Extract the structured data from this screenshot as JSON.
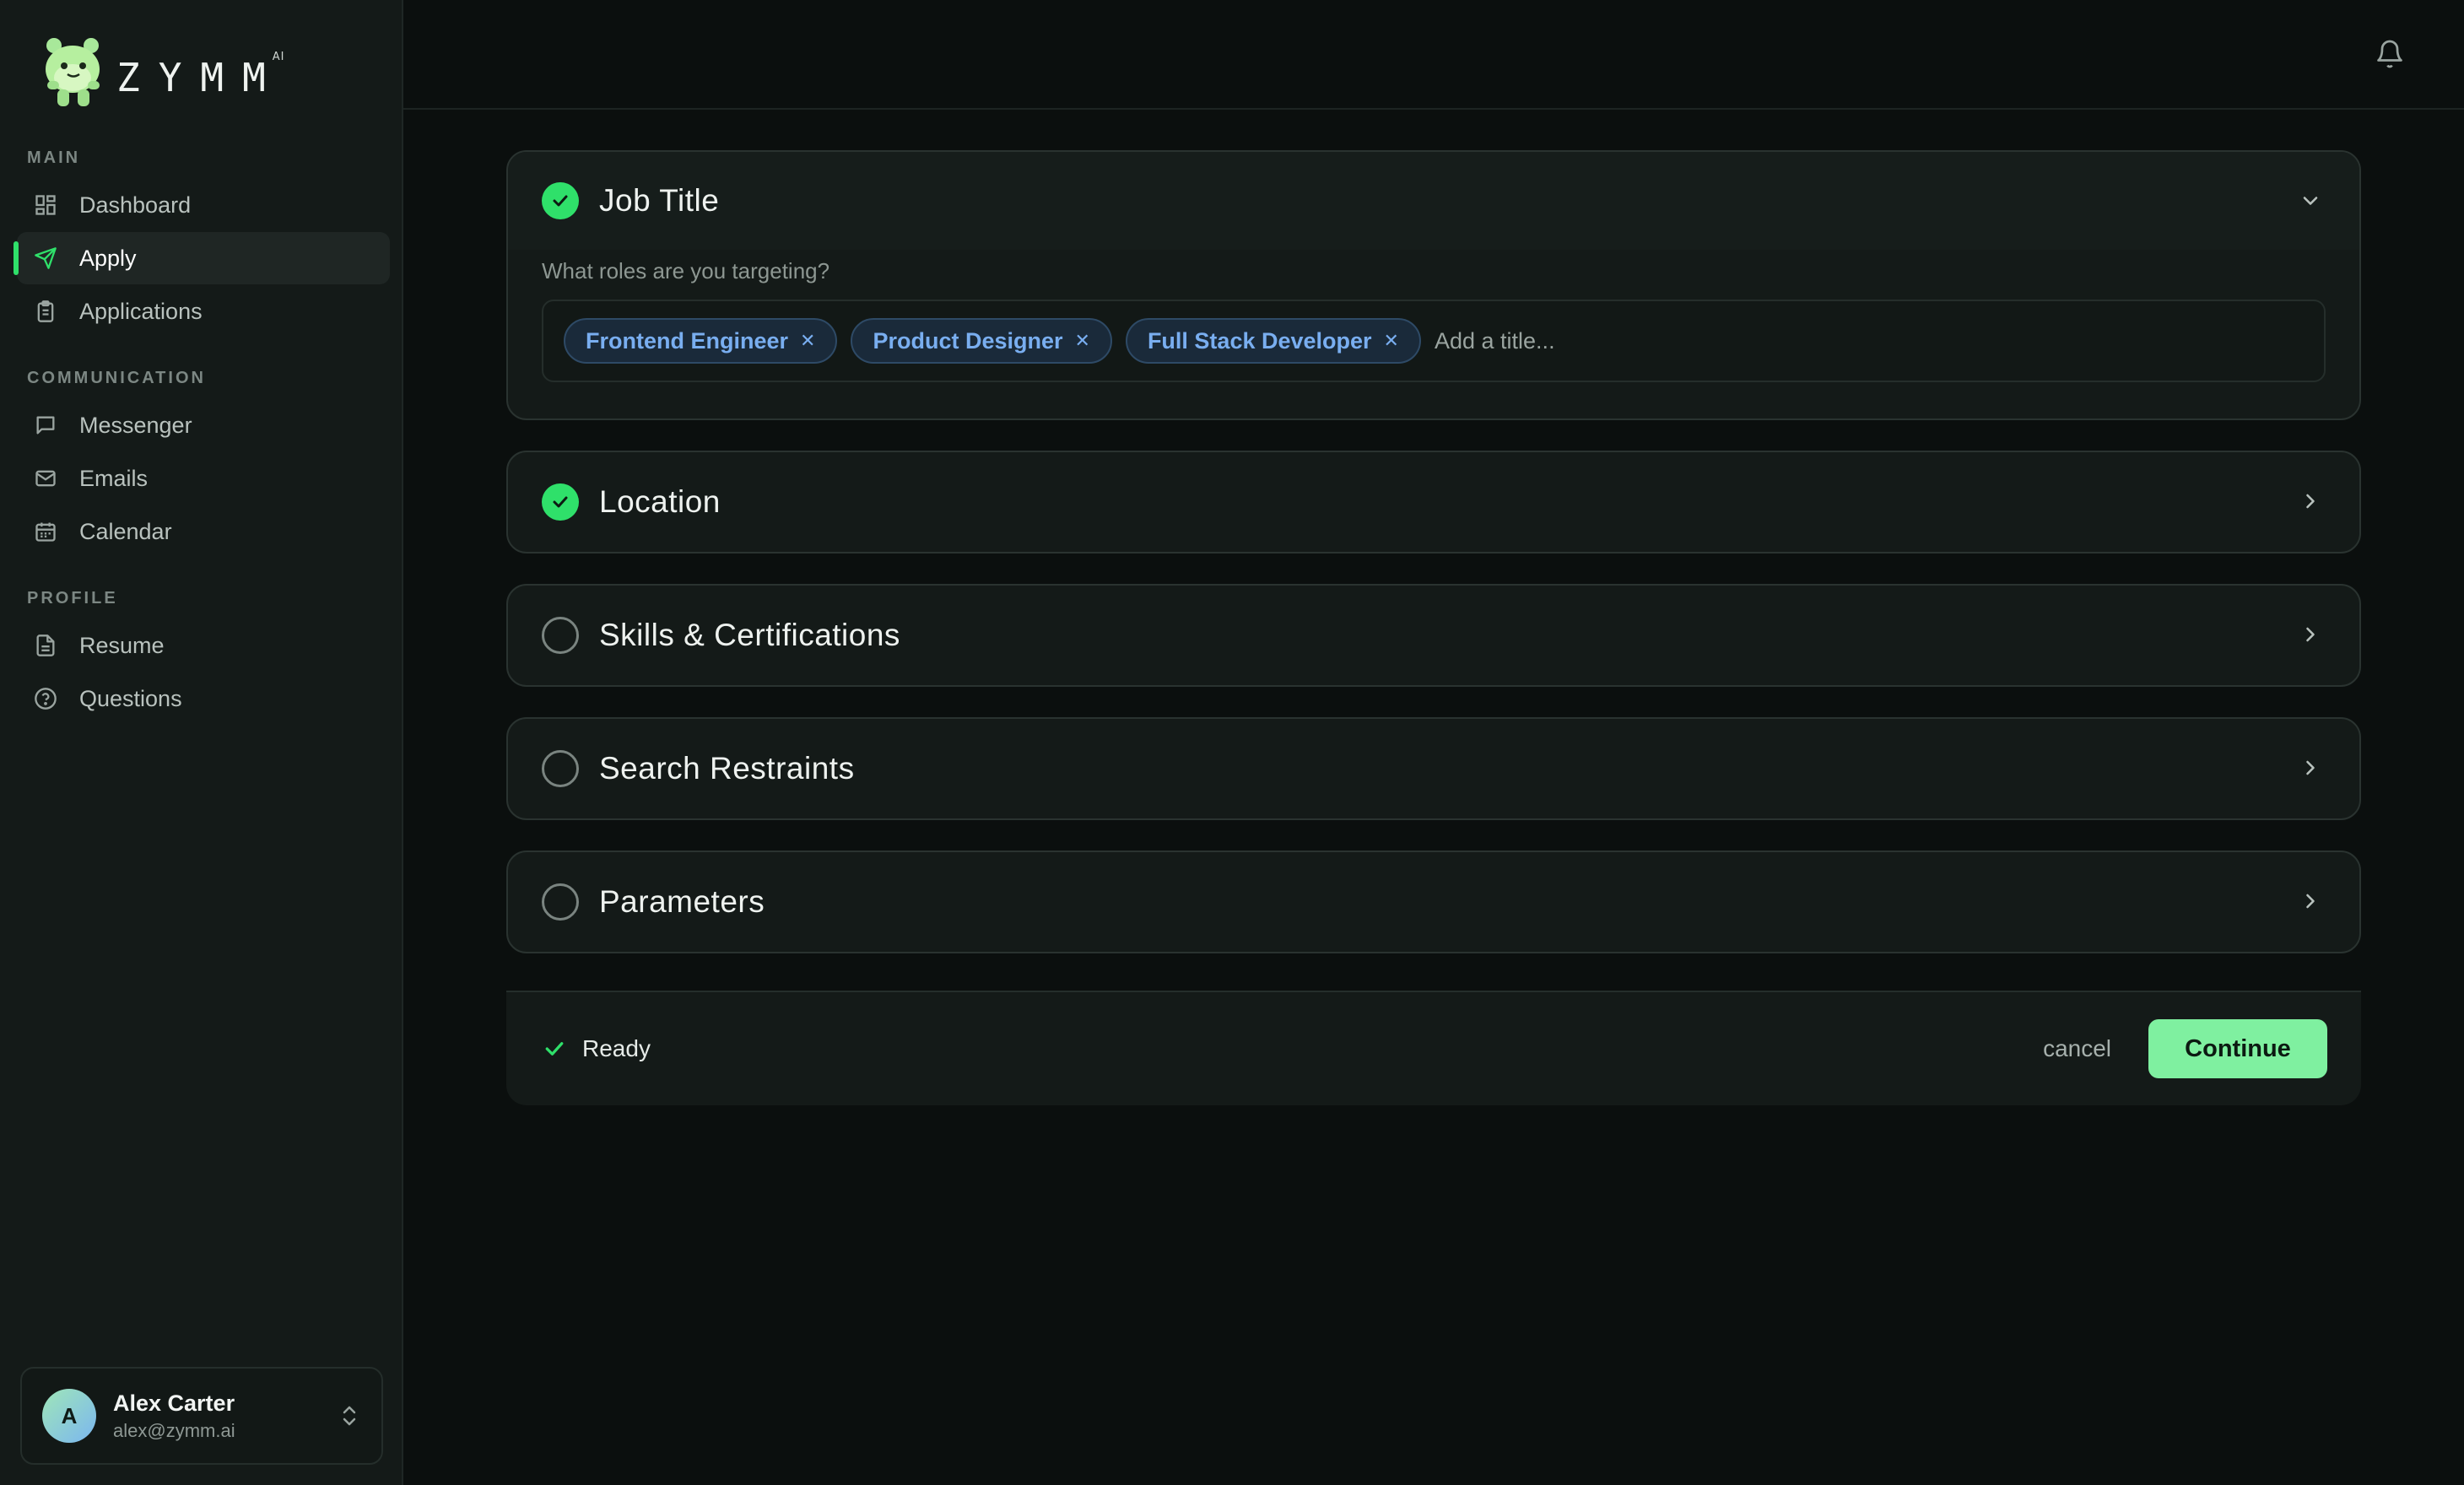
{
  "brand": {
    "name": "ZYMM",
    "superscript": "AI"
  },
  "sidebar": {
    "sections": [
      {
        "label": "MAIN"
      },
      {
        "label": "COMMUNICATION"
      },
      {
        "label": "PROFILE"
      }
    ],
    "items": [
      {
        "label": "Dashboard",
        "icon": "grid-icon"
      },
      {
        "label": "Apply",
        "icon": "send-icon",
        "active": true
      },
      {
        "label": "Applications",
        "icon": "clipboard-icon"
      },
      {
        "label": "Messenger",
        "icon": "message-icon"
      },
      {
        "label": "Emails",
        "icon": "mail-icon"
      },
      {
        "label": "Calendar",
        "icon": "calendar-icon"
      },
      {
        "label": "Resume",
        "icon": "document-icon"
      },
      {
        "label": "Questions",
        "icon": "help-circle-icon"
      }
    ]
  },
  "user": {
    "initial": "A",
    "name": "Alex Carter",
    "email": "alex@zymm.ai"
  },
  "job_title": {
    "title": "Job Title",
    "question": "What roles are you targeting?",
    "tags": [
      "Frontend Engineer",
      "Product Designer",
      "Full Stack Developer"
    ],
    "placeholder": "Add a title..."
  },
  "sections": [
    {
      "title": "Location",
      "done": true
    },
    {
      "title": "Skills & Certifications",
      "done": false
    },
    {
      "title": "Search Restraints",
      "done": false
    },
    {
      "title": "Parameters",
      "done": false
    }
  ],
  "footer": {
    "status": "Ready",
    "cancel_label": "cancel",
    "continue_label": "Continue"
  },
  "colors": {
    "accent": "#2fe06a",
    "button": "#7ff0a0",
    "tag_text": "#79aef0"
  }
}
